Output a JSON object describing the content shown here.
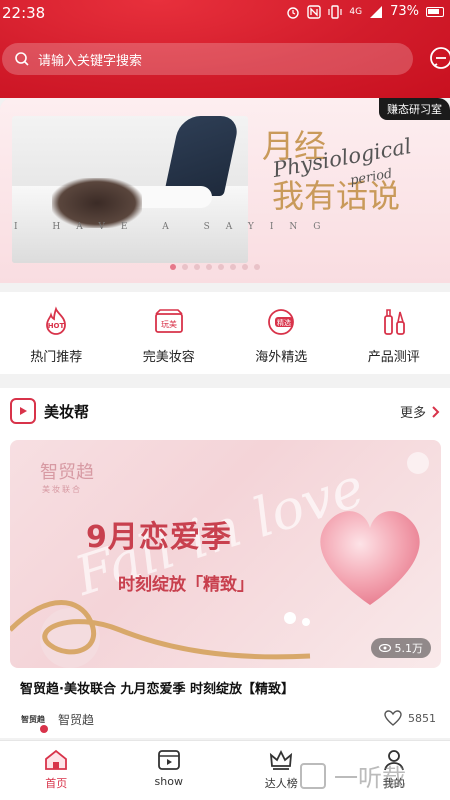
{
  "status_bar": {
    "time": "22:38",
    "network": "4G",
    "battery": "73%"
  },
  "search": {
    "placeholder": "请输入关键字搜索"
  },
  "banner": {
    "tag": "赚态研习室",
    "title_line1": "月经",
    "title_line2": "我有话说",
    "script_main": "Physiological",
    "script_sub": "period",
    "caption": "I HAVE A SAYING",
    "slides_total": 8,
    "active_slide": 0
  },
  "categories": [
    {
      "label": "热门推荐",
      "icon": "hot-icon",
      "badge": "HOT"
    },
    {
      "label": "完美妆容",
      "icon": "makeup-icon",
      "badge": "玩美"
    },
    {
      "label": "海外精选",
      "icon": "overseas-icon",
      "badge": "精选"
    },
    {
      "label": "产品测评",
      "icon": "review-icon"
    }
  ],
  "section": {
    "title": "美妆帮",
    "more": "更多",
    "video": {
      "brand": "智贸趋",
      "brand_sub": "美妆联合",
      "script": "Fall in love",
      "headline": "9月恋爱季",
      "subline": "时刻绽放「精致」",
      "views": "5.1万"
    },
    "post_title": "智贸趋·美妆联合 九月恋爱季 时刻绽放【精致】",
    "author": {
      "name": "智贸趋",
      "avatar_text": "智贸趋"
    },
    "likes": "5851"
  },
  "tabs": [
    {
      "label": "首页",
      "icon": "home-icon",
      "active": true
    },
    {
      "label": "show",
      "icon": "video-icon",
      "active": false
    },
    {
      "label": "达人榜",
      "icon": "crown-icon",
      "active": false
    },
    {
      "label": "我的",
      "icon": "profile-icon",
      "active": false
    }
  ],
  "watermark": "一听载",
  "colors": {
    "brand_red": "#d21c2b",
    "accent": "#d8334a",
    "gold": "#c99a5a"
  }
}
